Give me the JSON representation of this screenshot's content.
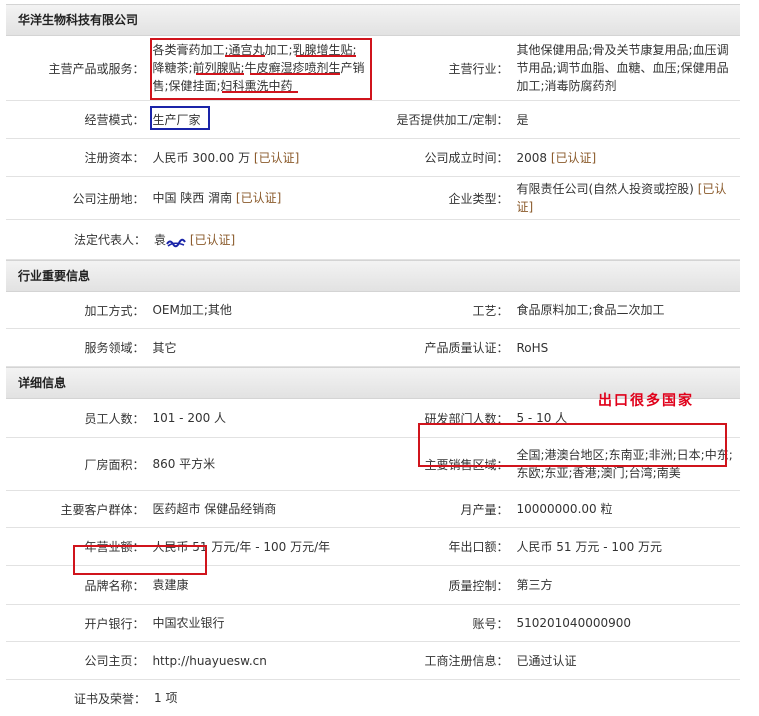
{
  "company": {
    "name": "华洋生物科技有限公司"
  },
  "basic": {
    "main_products_label": "主营产品或服务：",
    "main_products": "各类膏药加工;通宫丸加工;乳腺增生贴;降糖茶;前列腺贴;牛皮癣湿疹喷剂生产销售;保健挂面;妇科熏洗中药",
    "industry_label": "主营行业：",
    "industry": "其他保健用品;骨及关节康复用品;血压调节用品;调节血脂、血糖、血压;保健用品加工;消毒防腐药剂",
    "mode_label": "经营模式：",
    "mode": "生产厂家",
    "custom_label": "是否提供加工/定制：",
    "custom": "是",
    "capital_label": "注册资本：",
    "capital": "人民币 300.00 万",
    "capital_cert": "[已认证]",
    "founded_label": "公司成立时间：",
    "founded": "2008",
    "founded_cert": "[已认证]",
    "reg_place_label": "公司注册地：",
    "reg_place": "中国 陕西 渭南",
    "reg_place_cert": "[已认证]",
    "ent_type_label": "企业类型：",
    "ent_type": "有限责任公司(自然人投资或控股)",
    "ent_type_cert": "[已认证]",
    "legal_label": "法定代表人：",
    "legal": "袁",
    "legal_cert": "[已认证]"
  },
  "industry_info": {
    "title": "行业重要信息",
    "process_label": "加工方式：",
    "process": "OEM加工;其他",
    "craft_label": "工艺：",
    "craft": "食品原料加工;食品二次加工",
    "service_label": "服务领域：",
    "service": "其它",
    "quality_cert_label": "产品质量认证：",
    "quality_cert": "RoHS"
  },
  "detail": {
    "title": "详细信息",
    "staff_label": "员工人数：",
    "staff": "101 - 200 人",
    "rd_label": "研发部门人数：",
    "rd": "5 - 10 人",
    "area_label": "厂房面积：",
    "area": "860 平方米",
    "sales_region_label": "主要销售区域：",
    "sales_region": "全国;港澳台地区;东南亚;非洲;日本;中东;东欧;东亚;香港;澳门;台湾;南美",
    "customers_label": "主要客户群体：",
    "customers": "医药超市 保健品经销商",
    "monthly_label": "月产量：",
    "monthly": "10000000.00 粒",
    "revenue_label": "年营业额：",
    "revenue": "人民币 51 万元/年 - 100 万元/年",
    "export_label": "年出口额：",
    "export": "人民币 51 万元 - 100 万元",
    "brand_label": "品牌名称：",
    "brand": "袁建康",
    "qc_label": "质量控制：",
    "qc": "第三方",
    "bank_label": "开户银行：",
    "bank": "中国农业银行",
    "account_label": "账号：",
    "account": "510201040000900",
    "homepage_label": "公司主页：",
    "homepage": "http://huayuesw.cn",
    "biz_reg_label": "工商注册信息：",
    "biz_reg": "已通过认证",
    "certs_label": "证书及荣誉：",
    "certs": "1 项"
  },
  "annotation": {
    "export_note": "出口很多国家"
  },
  "colors": {
    "annotation_red": "#d0141c",
    "annotation_blue": "#1a24a8",
    "cert_brown": "#8a5a2b"
  }
}
